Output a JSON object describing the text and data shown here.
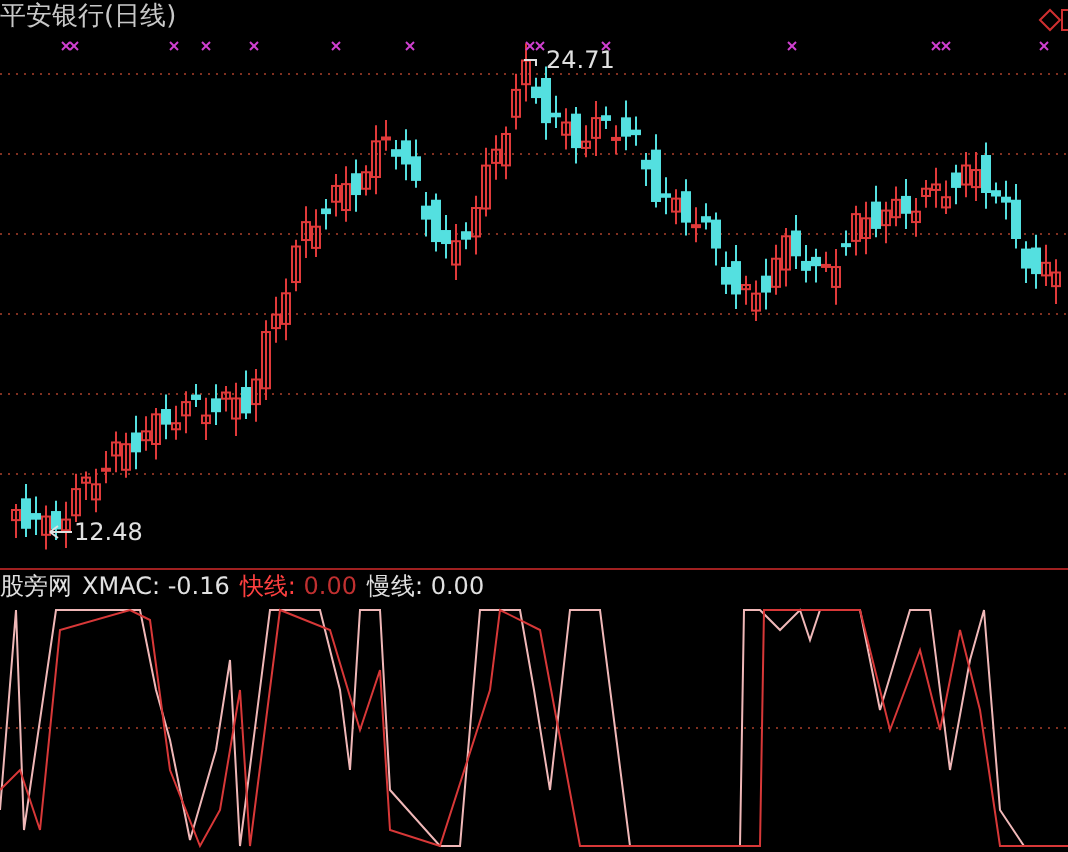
{
  "stock_panel": {
    "title": "平安银行(日线)",
    "high_label": "24.71",
    "low_label": "12.48"
  },
  "indicator_panel": {
    "name": "股旁网",
    "xmac": {
      "label": "XMAC:",
      "value": "-0.16"
    },
    "fast": {
      "label": "快线:",
      "value": "0.00"
    },
    "slow": {
      "label": "慢线:",
      "value": "0.00"
    }
  }
}
